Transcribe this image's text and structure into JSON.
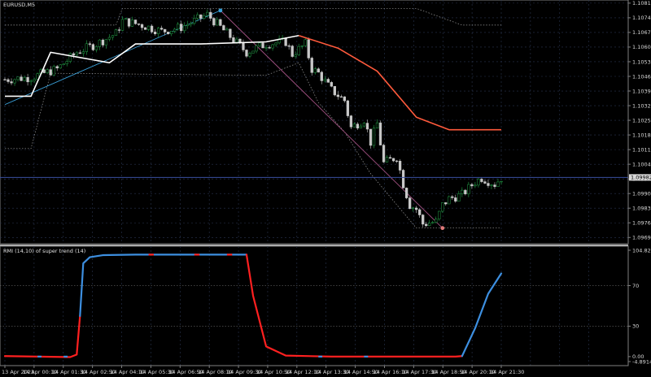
{
  "app": {
    "symbol_label": "EURUSD,M5",
    "indicator_label": "RMI (14,10) of super trend (14)",
    "colors": {
      "background": "#000000",
      "grid": "#2a3550",
      "frame": "#808080",
      "candle_up": "#24a148",
      "candle_down": "#c8c8c8",
      "supertrend_up": "#ffffff",
      "supertrend_down": "#ff5a3c",
      "envelope": "#9a9a9a",
      "trendline": "#3aa0d8",
      "trendline_fall": "#a05080",
      "rmi_up": "#3d8fe0",
      "rmi_down": "#ff2020",
      "current_price_line": "#3a4fa0"
    }
  },
  "chart_data": [
    {
      "type": "candlestick",
      "title": "EURUSD,M5",
      "y_ticks": [
        "1.10815",
        "1.10745",
        "1.10675",
        "1.10605",
        "1.10535",
        "1.10465",
        "1.10395",
        "1.10325",
        "1.10255",
        "1.10185",
        "1.10115",
        "1.10045",
        "1.09975",
        "1.09905",
        "1.09835",
        "1.09765",
        "1.09695"
      ],
      "ylim": [
        1.09665,
        1.1083
      ],
      "x_ticks": [
        "13 Apr 2023",
        "14 Apr 00:10",
        "14 Apr 01:30",
        "14 Apr 02:50",
        "14 Apr 04:10",
        "14 Apr 05:30",
        "14 Apr 06:50",
        "14 Apr 08:10",
        "14 Apr 09:30",
        "14 Apr 10:50",
        "14 Apr 12:10",
        "14 Apr 13:30",
        "14 Apr 14:50",
        "14 Apr 16:10",
        "14 Apr 17:30",
        "14 Apr 18:50",
        "14 Apr 20:10",
        "14 Apr 21:30"
      ],
      "current_price": 1.09982,
      "current_price_label": "1.09982",
      "close_path": [
        [
          0,
          1.1045
        ],
        [
          4,
          1.1046
        ],
        [
          8,
          1.105
        ],
        [
          11,
          1.1058
        ],
        [
          14,
          1.1062
        ],
        [
          17,
          1.1067
        ],
        [
          18,
          1.1073
        ],
        [
          21,
          1.1071
        ],
        [
          24,
          1.1068
        ],
        [
          27,
          1.107
        ],
        [
          29,
          1.1073
        ],
        [
          31,
          1.1076
        ],
        [
          33,
          1.107
        ],
        [
          35,
          1.1064
        ],
        [
          37,
          1.1058
        ],
        [
          40,
          1.1062
        ],
        [
          43,
          1.1063
        ],
        [
          44,
          1.1057
        ],
        [
          46,
          1.1062
        ],
        [
          47,
          1.105
        ],
        [
          48,
          1.1048
        ],
        [
          50,
          1.104
        ],
        [
          52,
          1.1035
        ],
        [
          53,
          1.1022
        ],
        [
          55,
          1.1026
        ],
        [
          56,
          1.1015
        ],
        [
          57,
          1.1024
        ],
        [
          58,
          1.1005
        ],
        [
          60,
          1.1008
        ],
        [
          61,
          1.0995
        ],
        [
          62,
          1.0985
        ],
        [
          63,
          1.0983
        ],
        [
          64,
          1.0976
        ],
        [
          66,
          1.0977
        ],
        [
          67,
          1.0985
        ],
        [
          68,
          1.0988
        ],
        [
          70,
          1.099
        ],
        [
          72,
          1.0996
        ],
        [
          73,
          1.0998
        ],
        [
          75,
          1.0995
        ],
        [
          76,
          1.0998
        ]
      ],
      "supertrend": [
        {
          "trend": "up",
          "points": [
            [
              0,
              1.1037
            ],
            [
              4,
              1.1037
            ],
            [
              7,
              1.1058
            ],
            [
              16,
              1.1053
            ],
            [
              20,
              1.1062
            ],
            [
              30,
              1.1062
            ],
            [
              40,
              1.1063
            ],
            [
              45,
              1.1066
            ]
          ]
        },
        {
          "trend": "down",
          "points": [
            [
              45,
              1.1066
            ],
            [
              51,
              1.106
            ],
            [
              57,
              1.1049
            ],
            [
              63,
              1.1027
            ],
            [
              68,
              1.1021
            ],
            [
              76,
              1.1021
            ]
          ]
        }
      ],
      "envelope_upper": [
        [
          0,
          1.1071
        ],
        [
          17,
          1.1071
        ],
        [
          18,
          1.1079
        ],
        [
          63,
          1.1079
        ],
        [
          70,
          1.1071
        ],
        [
          76,
          1.1071
        ]
      ],
      "envelope_lower": [
        [
          0,
          1.1012
        ],
        [
          4,
          1.1012
        ],
        [
          7,
          1.1048
        ],
        [
          40,
          1.1047
        ],
        [
          45,
          1.1053
        ],
        [
          48,
          1.1034
        ],
        [
          52,
          1.102
        ],
        [
          56,
          1.1
        ],
        [
          63,
          1.0974
        ],
        [
          76,
          1.0974
        ]
      ],
      "trend_line_up": [
        [
          0,
          1.1033
        ],
        [
          33,
          1.1078
        ]
      ],
      "trend_line_down": [
        [
          33,
          1.1078
        ],
        [
          67,
          1.0974
        ]
      ],
      "marker_high": [
        33,
        1.1078
      ],
      "marker_low": [
        67,
        1.0974
      ]
    },
    {
      "type": "line",
      "title": "RMI (14,10) of super trend (14)",
      "y_ticks": [
        "104.827",
        "70",
        "30",
        "0.00",
        "-4.8914"
      ],
      "ylim": [
        -4.8914,
        104.827
      ],
      "levels": [
        70,
        30
      ],
      "series": [
        {
          "trend": "down",
          "points": [
            [
              0,
              0.5
            ],
            [
              10,
              -0.5
            ],
            [
              11,
              2
            ],
            [
              11.5,
              40
            ]
          ]
        },
        {
          "trend": "up",
          "points": [
            [
              11.5,
              40
            ],
            [
              12,
              92
            ],
            [
              13,
              98
            ],
            [
              15,
              100
            ],
            [
              20,
              100.5
            ],
            [
              37,
              100.5
            ]
          ]
        },
        {
          "trend": "down",
          "points": [
            [
              37,
              100.5
            ],
            [
              38,
              60
            ],
            [
              40,
              10
            ],
            [
              43,
              1
            ],
            [
              50,
              0
            ],
            [
              69,
              0
            ],
            [
              70,
              0.5
            ]
          ]
        },
        {
          "trend": "up",
          "points": [
            [
              70,
              0.5
            ],
            [
              72,
              28
            ],
            [
              74,
              62
            ],
            [
              76,
              82
            ]
          ]
        }
      ]
    }
  ]
}
